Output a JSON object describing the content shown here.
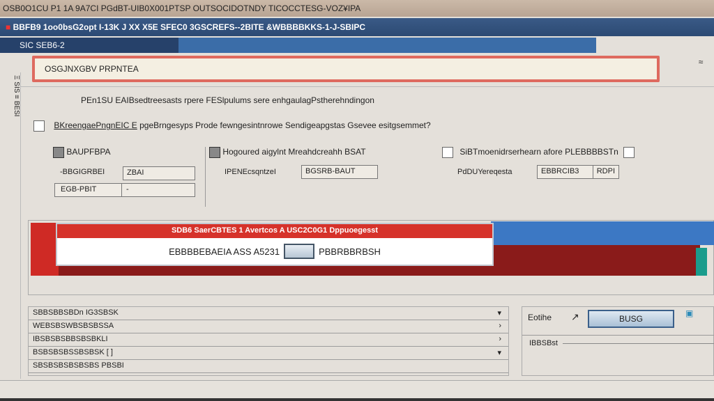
{
  "top_menu": "OSB0O1CU P1 1A 9A7CI  PGdBT-UIB0X001PTSP  OUTSOCIDOTNDY  TICOCCTESG-VOZ¥IPA",
  "title": "BBFB9 1oo0bsG2opt I-13K J XX X5E SFEC0 3GSCREFS--2BITE &WBBBBKKS-1-J-SBIPC",
  "tab_label": "SIC  SEB6-2",
  "address": "OSGJNXGBV PRPNTEA",
  "close_label": "≈",
  "left_rail": "Ξ SIS ≡ BESI",
  "panel": {
    "line1": "PEn1SU EAIBsedtreesasts rpere FESlpulums sere enhgaulagPstherehndingon",
    "line2_link": "BKreengaePngnEIC E",
    "line2": "pgeBrngesyps Prode fewngesintnrowe Sendigeapgstas Gsevee esitgsemmet?",
    "group1": {
      "title": "BAUPFBPA",
      "label": "-BBGIGRBEI",
      "value": "ZBAI",
      "combo": "EGB-PBIT",
      "combo_value": "-"
    },
    "group2": {
      "title": "Hogoured aigylnt Mreahdcreahh BSAT",
      "label": "IPENEcsqntzeI",
      "value": "BGSRB-BAUT"
    },
    "group3": {
      "title": "SiBTmoenidrserhearn afore PLEBBBBSTn",
      "label": "PdDUYereqesta",
      "value": "EBBRCIB3",
      "value2": "RDPI"
    }
  },
  "dialog": {
    "title": "SDB6 SaerCBTES 1 Avertcos A USC2C0G1 Dppuoegesst",
    "text": "EBBBBEBAEIA ASS A5231",
    "button_label": "",
    "right_text": "PBBRBBRBSH"
  },
  "list": {
    "rows": [
      {
        "label": "SBBSBBSBDn IG3SBSK",
        "arrow": "▾"
      },
      {
        "label": "WEBSBSWBSBSBSSA",
        "arrow": "›"
      },
      {
        "label": "IBSBSBSBBSBSBKLI",
        "arrow": "›"
      },
      {
        "label": "BSBSBSBSSBSBSK [ ]",
        "arrow": "▾"
      },
      {
        "label": "SBSBSBSBSBSBS PBSBI",
        "arrow": ""
      }
    ]
  },
  "side": {
    "label": "Eotihe",
    "button_label": "BUSG",
    "footer_label": "IBBSBst"
  }
}
